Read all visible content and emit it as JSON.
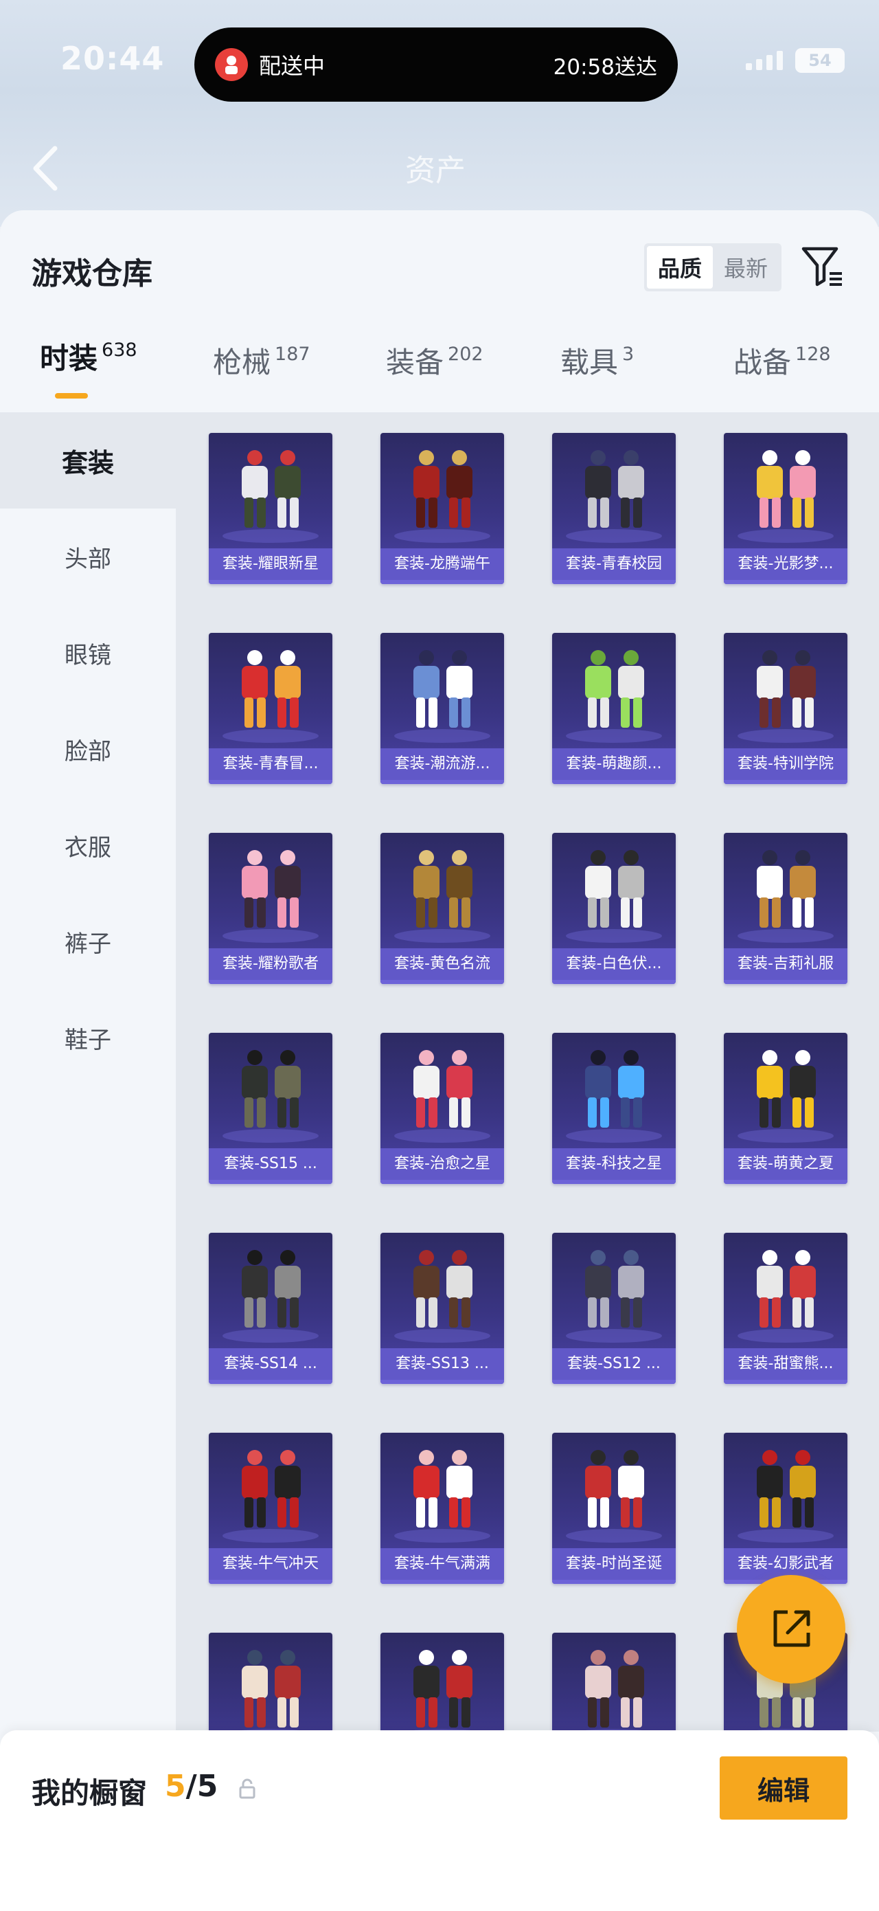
{
  "status_bar": {
    "time": "20:44",
    "battery": "54"
  },
  "dynamic_island": {
    "left_text": "配送中",
    "right_text": "20:58送达"
  },
  "background_header": {
    "title": "资产"
  },
  "panel": {
    "title": "游戏仓库"
  },
  "sort": {
    "options": [
      "品质",
      "最新"
    ],
    "selected": "品质"
  },
  "tabs": [
    {
      "label": "时装",
      "count": "638",
      "active": true
    },
    {
      "label": "枪械",
      "count": "187"
    },
    {
      "label": "装备",
      "count": "202"
    },
    {
      "label": "载具",
      "count": "3"
    },
    {
      "label": "战备",
      "count": "128"
    }
  ],
  "sidebar": {
    "items": [
      "套装",
      "头部",
      "眼镜",
      "脸部",
      "衣服",
      "裤子",
      "鞋子"
    ],
    "selected": "套装"
  },
  "items": [
    {
      "name": "套装-耀眼新星",
      "icon": "outfit-icon"
    },
    {
      "name": "套装-龙腾端午",
      "icon": "outfit-icon"
    },
    {
      "name": "套装-青春校园",
      "icon": "outfit-icon"
    },
    {
      "name": "套装-光影梦...",
      "icon": "outfit-icon"
    },
    {
      "name": "套装-青春冒...",
      "icon": "outfit-icon"
    },
    {
      "name": "套装-潮流游...",
      "icon": "outfit-icon"
    },
    {
      "name": "套装-萌趣颜...",
      "icon": "outfit-icon"
    },
    {
      "name": "套装-特训学院",
      "icon": "outfit-icon"
    },
    {
      "name": "套装-耀粉歌者",
      "icon": "outfit-icon"
    },
    {
      "name": "套装-黄色名流",
      "icon": "outfit-icon"
    },
    {
      "name": "套装-白色伏...",
      "icon": "outfit-icon"
    },
    {
      "name": "套装-吉莉礼服",
      "icon": "outfit-icon"
    },
    {
      "name": "套装-SS15 ...",
      "icon": "outfit-icon"
    },
    {
      "name": "套装-治愈之星",
      "icon": "outfit-icon"
    },
    {
      "name": "套装-科技之星",
      "icon": "outfit-icon"
    },
    {
      "name": "套装-萌黄之夏",
      "icon": "outfit-icon"
    },
    {
      "name": "套装-SS14 ...",
      "icon": "outfit-icon"
    },
    {
      "name": "套装-SS13 ...",
      "icon": "outfit-icon"
    },
    {
      "name": "套装-SS12 ...",
      "icon": "outfit-icon"
    },
    {
      "name": "套装-甜蜜熊...",
      "icon": "outfit-icon"
    },
    {
      "name": "套装-牛气冲天",
      "icon": "outfit-icon"
    },
    {
      "name": "套装-牛气满满",
      "icon": "outfit-icon"
    },
    {
      "name": "套装-时尚圣诞",
      "icon": "outfit-icon"
    },
    {
      "name": "套装-幻影武者",
      "icon": "outfit-icon"
    },
    {
      "name": "",
      "icon": "outfit-icon"
    },
    {
      "name": "",
      "icon": "outfit-icon"
    },
    {
      "name": "",
      "icon": "outfit-icon"
    },
    {
      "name": "",
      "icon": "outfit-icon"
    }
  ],
  "showcase": {
    "label": "我的橱窗",
    "current": "5",
    "separator": "/",
    "total": "5"
  },
  "edit_label": "编辑",
  "colors": {
    "accent": "#f6a71e",
    "card_bg": "#3a3584",
    "card_label_bg": "#6158c8",
    "island": "#050505"
  }
}
